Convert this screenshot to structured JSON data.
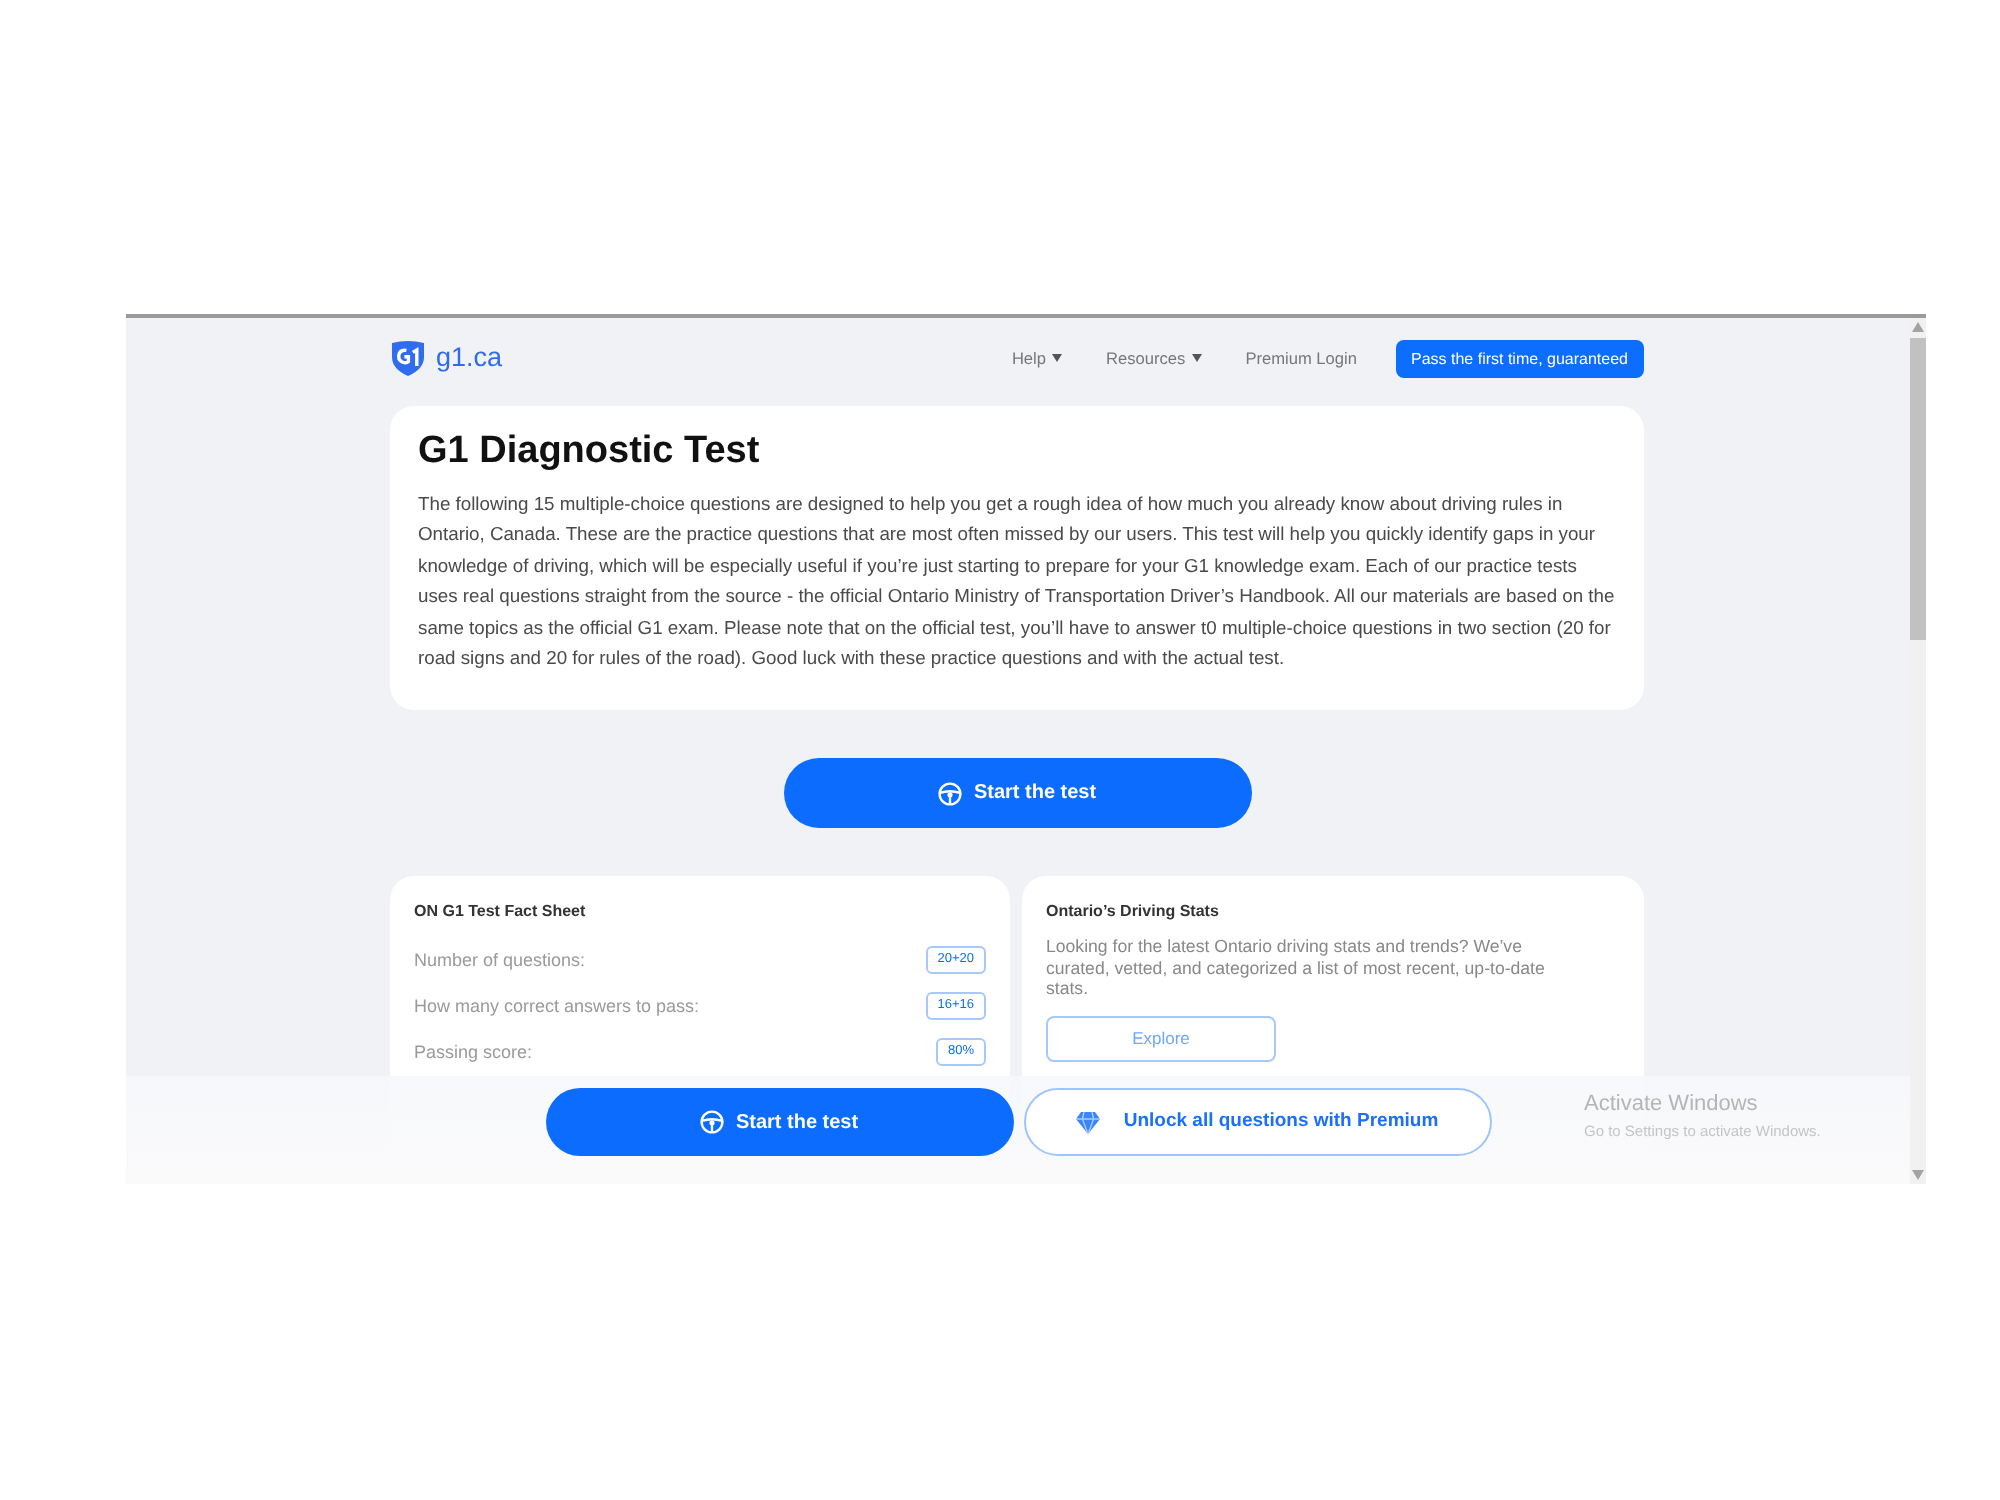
{
  "nav": {
    "logo_text": "g1.ca",
    "links": [
      {
        "label": "Help",
        "kind": "dropdown"
      },
      {
        "label": "Resources",
        "kind": "dropdown"
      },
      {
        "label": "Premium Login",
        "kind": "link"
      }
    ],
    "cta": "Pass the first time, guaranteed"
  },
  "intro": {
    "title": "G1 Diagnostic Test",
    "text": "The following 15 multiple-choice questions are designed to help you get a rough idea of how much you already know about driving rules in Ontario, Canada. These are the practice questions that are most often missed by our users. This test will help you quickly identify gaps in your knowledge of driving, which will be especially useful if you’re just starting to prepare for your G1 knowledge exam. Each of our practice tests uses real questions straight from the source - the official Ontario Ministry of Transportation Driver’s Handbook. All our materials are based on the same topics as the official G1 exam. Please note that on the official test, you’ll have to answer t0 multiple-choice questions in two section (20 for road signs and 20 for rules of the road). Good luck with these practice questions and with the actual test."
  },
  "start_button": {
    "label": "Start the test"
  },
  "fact_sheet": {
    "title": "ON G1 Test Fact Sheet",
    "rows": [
      {
        "label": "Number of questions:",
        "value": "20+20"
      },
      {
        "label": "How many correct answers to pass:",
        "value": "16+16"
      },
      {
        "label": "Passing score:",
        "value": "80%"
      }
    ]
  },
  "stats_card": {
    "title": "Ontario’s Driving Stats",
    "text": "Looking for the latest Ontario driving stats and trends? We’ve curated, vetted, and categorized a list of most recent, up-to-date stats.",
    "button": "Explore"
  },
  "bottom_bar": {
    "buttons": [
      {
        "kind": "primary",
        "label": "Start the test"
      },
      {
        "kind": "outline",
        "label": "Unlock all questions with Premium"
      }
    ]
  },
  "os_notice": {
    "title": "Activate Windows",
    "subtitle": "Go to Settings to activate Windows."
  }
}
